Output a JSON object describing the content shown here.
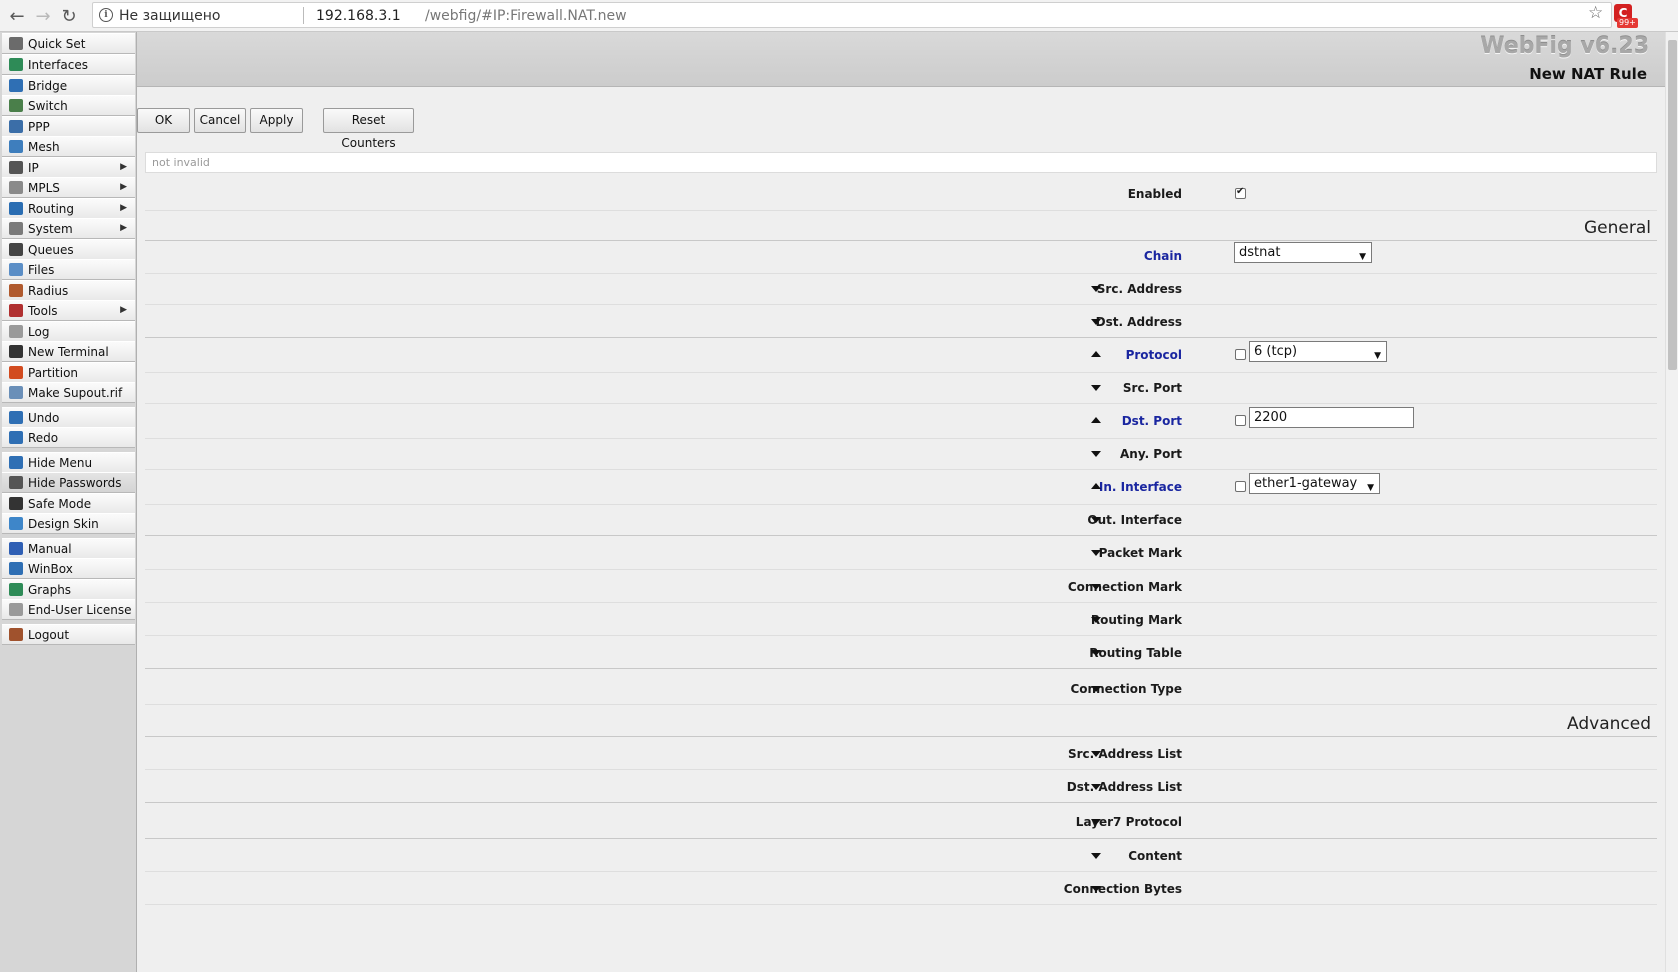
{
  "browser": {
    "security_label": "Не защищено",
    "url_host": "192.168.3.1",
    "url_path": "/webfig/#IP:Firewall.NAT.new",
    "extension_badge": "99+",
    "extension_letter": "C"
  },
  "sidebar": {
    "items": [
      {
        "label": "Quick Set",
        "icon": "wand-icon",
        "color": "#6b6b6b"
      },
      {
        "label": "Interfaces",
        "icon": "interfaces-icon",
        "color": "#2e8b57"
      },
      {
        "label": "Bridge",
        "icon": "bridge-icon",
        "color": "#2f6fb4"
      },
      {
        "label": "Switch",
        "icon": "switch-icon",
        "color": "#4a7f4a"
      },
      {
        "label": "PPP",
        "icon": "ppp-icon",
        "color": "#3b6ea8"
      },
      {
        "label": "Mesh",
        "icon": "mesh-icon",
        "color": "#3e7ebd"
      },
      {
        "label": "IP",
        "icon": "ip-icon",
        "color": "#555555",
        "submenu": true
      },
      {
        "label": "MPLS",
        "icon": "mpls-icon",
        "color": "#8a8a8a",
        "submenu": true
      },
      {
        "label": "Routing",
        "icon": "routing-icon",
        "color": "#2a6db2",
        "submenu": true
      },
      {
        "label": "System",
        "icon": "system-icon",
        "color": "#7a7a7a",
        "submenu": true
      },
      {
        "label": "Queues",
        "icon": "queues-icon",
        "color": "#444444"
      },
      {
        "label": "Files",
        "icon": "files-icon",
        "color": "#5b8ec6"
      },
      {
        "label": "Radius",
        "icon": "radius-icon",
        "color": "#b05a2e"
      },
      {
        "label": "Tools",
        "icon": "tools-icon",
        "color": "#b03030",
        "submenu": true
      },
      {
        "label": "Log",
        "icon": "log-icon",
        "color": "#9a9a9a"
      },
      {
        "label": "New Terminal",
        "icon": "terminal-icon",
        "color": "#333333"
      },
      {
        "label": "Partition",
        "icon": "partition-icon",
        "color": "#d24b1f"
      },
      {
        "label": "Make Supout.rif",
        "icon": "supout-icon",
        "color": "#6a8fb8"
      },
      {
        "label": "Undo",
        "icon": "undo-icon",
        "color": "#2f6fb4"
      },
      {
        "label": "Redo",
        "icon": "redo-icon",
        "color": "#2f6fb4"
      },
      {
        "label": "Hide Menu",
        "icon": "hide-menu-icon",
        "color": "#2f6fb4"
      },
      {
        "label": "Hide Passwords",
        "icon": "hide-passwords-icon",
        "color": "#555555"
      },
      {
        "label": "Safe Mode",
        "icon": "safe-mode-icon",
        "color": "#333333"
      },
      {
        "label": "Design Skin",
        "icon": "design-skin-icon",
        "color": "#3e86c9"
      },
      {
        "label": "Manual",
        "icon": "manual-icon",
        "color": "#2f5fb4"
      },
      {
        "label": "WinBox",
        "icon": "winbox-icon",
        "color": "#2f6fb4"
      },
      {
        "label": "Graphs",
        "icon": "graphs-icon",
        "color": "#2e8b57"
      },
      {
        "label": "End-User License",
        "icon": "license-icon",
        "color": "#9a9a9a"
      },
      {
        "label": "Logout",
        "icon": "logout-icon",
        "color": "#a0522d"
      }
    ]
  },
  "header": {
    "brand": "WebFig v6.23",
    "title": "New NAT Rule"
  },
  "toolbar": {
    "ok": "OK",
    "cancel": "Cancel",
    "apply": "Apply",
    "reset": "Reset Counters"
  },
  "status": "not invalid",
  "form": {
    "enabled_label": "Enabled",
    "enabled_checked": true,
    "general_title": "General",
    "advanced_title": "Advanced",
    "chain": {
      "label": "Chain",
      "value": "dstnat"
    },
    "protocol": {
      "label": "Protocol",
      "value": "6 (tcp)"
    },
    "dst_port": {
      "label": "Dst. Port",
      "value": "2200"
    },
    "in_interface": {
      "label": "In. Interface",
      "value": "ether1-gateway"
    },
    "collapsed": {
      "src_address": "Src. Address",
      "dst_address": "Dst. Address",
      "src_port": "Src. Port",
      "any_port": "Any. Port",
      "out_interface": "Out. Interface",
      "packet_mark": "Packet Mark",
      "connection_mark": "Connection Mark",
      "routing_mark": "Routing Mark",
      "routing_table": "Routing Table",
      "connection_type": "Connection Type",
      "src_address_list": "Src. Address List",
      "dst_address_list": "Dst. Address List",
      "layer7_protocol": "Layer7 Protocol",
      "content": "Content",
      "connection_bytes": "Connection Bytes"
    }
  }
}
